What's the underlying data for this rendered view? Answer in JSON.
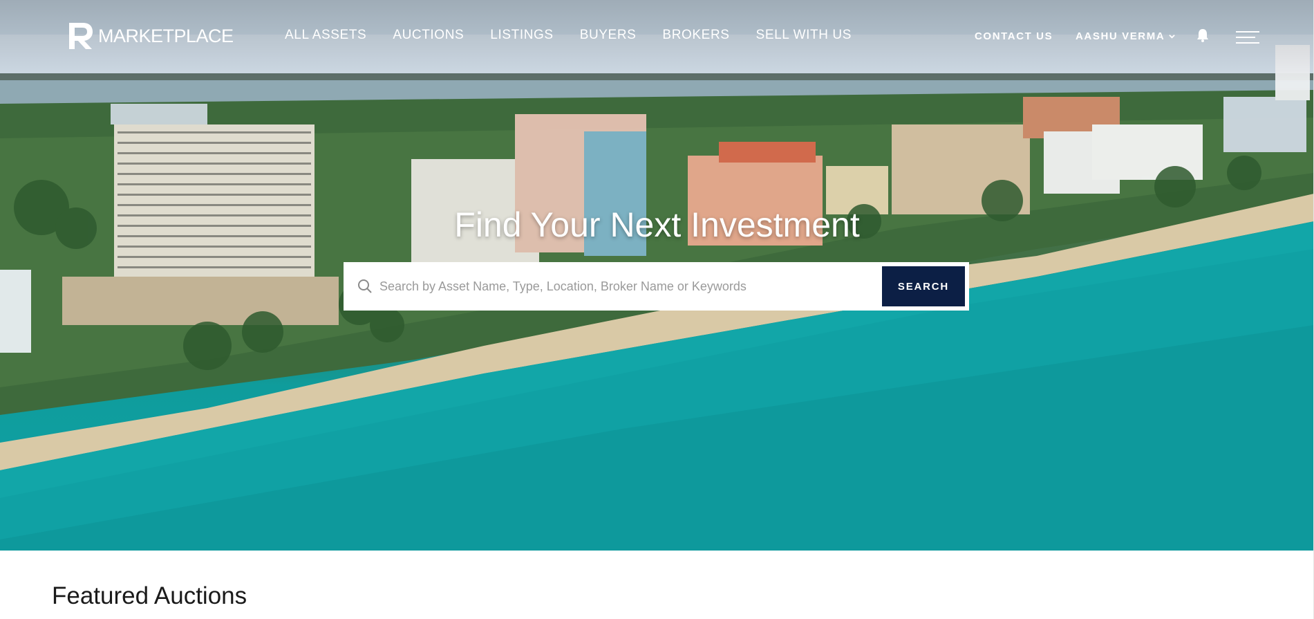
{
  "brand": {
    "name": "MARKETPLACE"
  },
  "nav": {
    "main": [
      {
        "label": "ALL ASSETS"
      },
      {
        "label": "AUCTIONS"
      },
      {
        "label": "LISTINGS"
      },
      {
        "label": "BUYERS"
      },
      {
        "label": "BROKERS"
      },
      {
        "label": "SELL WITH US"
      }
    ],
    "contact_label": "CONTACT US",
    "user_label": "AASHU VERMA",
    "icons": {
      "user_menu": "chevron-down-icon",
      "notifications": "bell-icon",
      "menu": "hamburger-menu-icon"
    }
  },
  "hero": {
    "headline": "Find Your Next Investment",
    "search": {
      "placeholder": "Search by Asset Name, Type, Location, Broker Name or Keywords",
      "value": "",
      "button_label": "SEARCH",
      "icon": "search-icon"
    }
  },
  "featured": {
    "title": "Featured Auctions"
  },
  "colors": {
    "button_bg": "#0c1f45",
    "ocean": "#0fa3a7",
    "text_dark": "#1a1a1a"
  }
}
